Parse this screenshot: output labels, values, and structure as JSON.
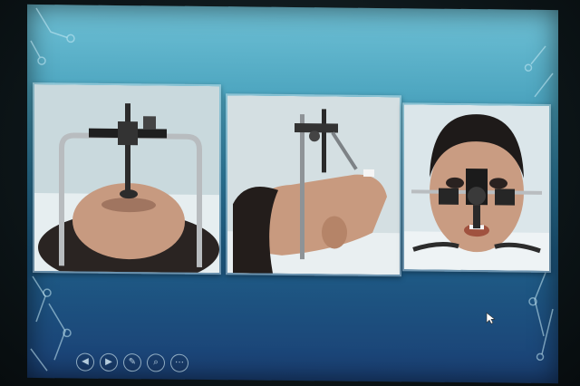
{
  "slide": {
    "background_colors": [
      "#6fc1d6",
      "#2f7fa3",
      "#1a3f74"
    ],
    "photos": [
      {
        "subject": "patient-supine-with-face-bow",
        "view": "front-top"
      },
      {
        "subject": "patient-supine-with-face-bow",
        "view": "side"
      },
      {
        "subject": "patient-supine-with-face-bow",
        "view": "front"
      }
    ],
    "toolbar": {
      "icons": [
        "prev-icon",
        "next-icon",
        "pen-icon",
        "zoom-icon",
        "more-icon"
      ],
      "glyphs": [
        "◀",
        "▶",
        "✎",
        "⌕",
        "⋯"
      ]
    }
  }
}
